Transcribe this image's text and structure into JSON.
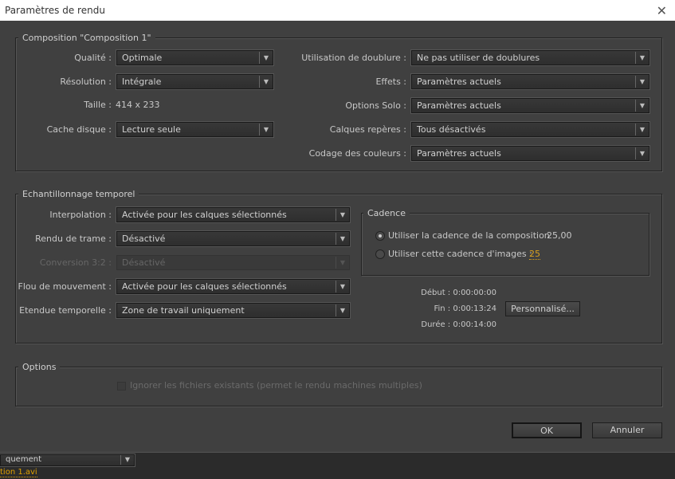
{
  "window": {
    "title": "Paramètres de rendu",
    "close": "✕"
  },
  "composition": {
    "legend": "Composition \"Composition 1\"",
    "quality_label": "Qualité :",
    "quality": "Optimale",
    "resolution_label": "Résolution :",
    "resolution": "Intégrale",
    "size_label": "Taille :",
    "size": "414 x 233",
    "disk_cache_label": "Cache disque :",
    "disk_cache": "Lecture seule",
    "proxy_label": "Utilisation de doublure :",
    "proxy": "Ne pas utiliser de doublures",
    "effects_label": "Effets :",
    "effects": "Paramètres actuels",
    "solo_label": "Options Solo :",
    "solo": "Paramètres actuels",
    "guide_label": "Calques repères :",
    "guide": "Tous désactivés",
    "color_label": "Codage des couleurs :",
    "color": "Paramètres actuels"
  },
  "time": {
    "legend": "Echantillonnage temporel",
    "interp_label": "Interpolation :",
    "interp": "Activée pour les calques sélectionnés",
    "field_label": "Rendu de trame :",
    "field": "Désactivé",
    "pulldown_label": "Conversion 3:2 :",
    "pulldown": "Désactivé",
    "motion_label": "Flou de mouvement :",
    "motion": "Activée pour les calques sélectionnés",
    "span_label": "Etendue temporelle :",
    "span": "Zone de travail uniquement",
    "cadence": {
      "legend": "Cadence",
      "opt1": "Utiliser la cadence de la composition",
      "opt1_value": "25,00",
      "opt2": "Utiliser cette cadence d'images :",
      "opt2_value": "25"
    },
    "start": "Début : 0:00:00:00",
    "end": "Fin : 0:00:13:24",
    "duration": "Durée : 0:00:14:00",
    "custom": "Personnalisé..."
  },
  "options": {
    "legend": "Options",
    "skip": "Ignorer les fichiers existants (permet le rendu machines multiples)"
  },
  "buttons": {
    "ok": "OK",
    "cancel": "Annuler"
  },
  "background": {
    "dropdown": "quement",
    "file": "tion 1.avi"
  },
  "arrow": "▼"
}
